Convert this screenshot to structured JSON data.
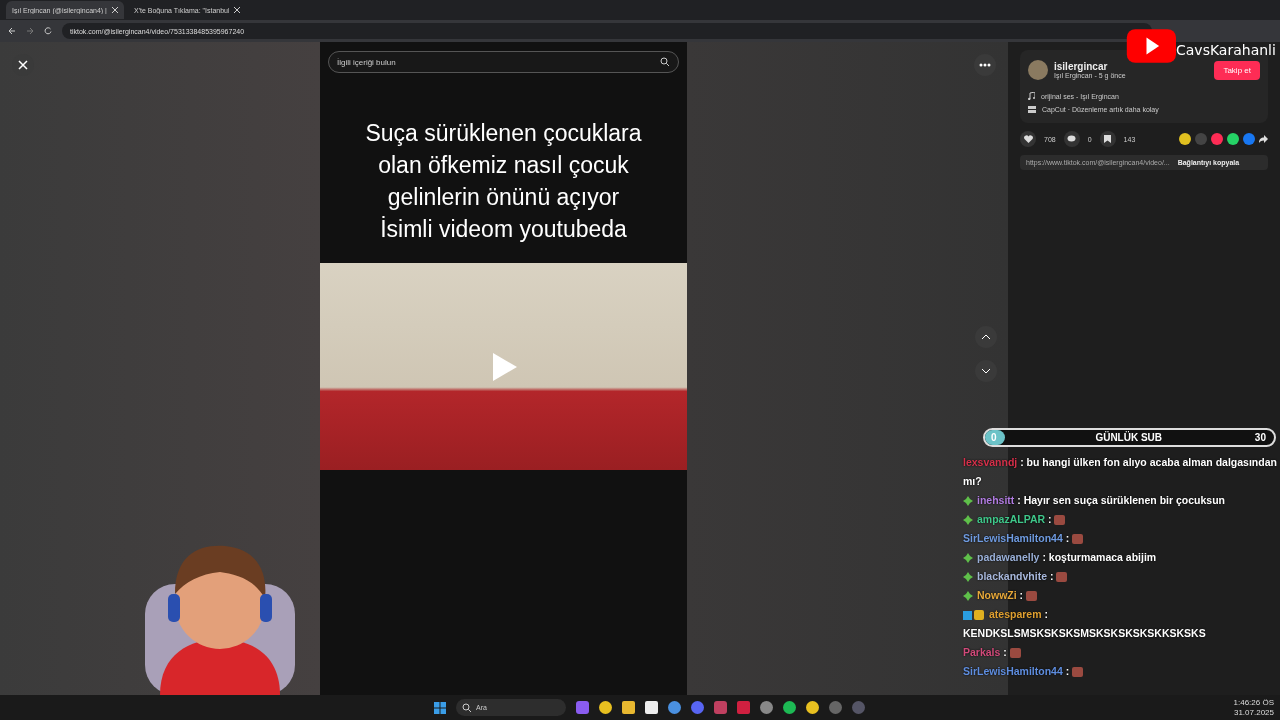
{
  "browser": {
    "tabs": [
      {
        "title": "Işıl Ergincan (@isilergincan4) |",
        "selected": true
      },
      {
        "title": "X'te Boğuna Tıklama: \"İstanbul",
        "selected": false
      }
    ],
    "url": "tiktok.com/@isilergincan4/video/7531338485395967240"
  },
  "video": {
    "search": {
      "placeholder": "İlgili içeriği bulun"
    },
    "caption_lines": [
      "Suça sürüklenen çocuklara",
      "olan öfkemiz nasıl çocuk",
      "gelinlerin önünü açıyor",
      "İsimli videom youtubeda"
    ]
  },
  "author": {
    "username": "isilergincar",
    "subtitle": "Işıl Ergincan - 5 g önce",
    "follow_button": "Takip et",
    "sound": "orijinal ses - Işıl Ergincan",
    "capcut": "CapCut · Düzenleme artık daha kolay",
    "likes": "708",
    "comments": "0",
    "saves": "143",
    "link": "https://www.tiktok.com/@isilergincan4/video/...",
    "copy_button": "Bağlantıyı kopyala"
  },
  "overlay": {
    "channel": "CavsKarahanli",
    "sub_goal": {
      "current": "0",
      "label": "GÜNLÜK SUB",
      "target": "30",
      "level": 0
    },
    "chat": [
      {
        "kind": "plain",
        "user": "lexsvanndj",
        "color": "#d6304a",
        "text": ": bu hangi ülken fon alıyo acaba alman dalgasından mı?",
        "emote": false
      },
      {
        "kind": "sub",
        "user": "inehsitt",
        "color": "#b07be0",
        "text": ": Hayır sen suça sürüklenen bir çocuksun",
        "emote": false
      },
      {
        "kind": "sub",
        "user": "ampazALPAR",
        "color": "#3fc78a",
        "text": ":",
        "emote": true
      },
      {
        "kind": "plain",
        "user": "SirLewisHamilton44",
        "color": "#6f9be0",
        "text": ":",
        "emote": true
      },
      {
        "kind": "sub",
        "user": "padawanelly",
        "color": "#9ab0d8",
        "text": ": koşturmamaca abijim",
        "emote": false
      },
      {
        "kind": "sub",
        "user": "blackandvhite",
        "color": "#a8b8dc",
        "text": ":",
        "emote": true
      },
      {
        "kind": "sub",
        "user": "NowwZi",
        "color": "#e8a93a",
        "text": ":",
        "emote": true
      },
      {
        "kind": "gifter",
        "user": "atesparem",
        "color": "#e0a030",
        "text": ": KENDKSLSMSKSKSKSMSKSKSKSKSKKSKSKS",
        "emote": false
      },
      {
        "kind": "plain",
        "user": "Parkals",
        "color": "#d24a7a",
        "text": ":",
        "emote": true
      },
      {
        "kind": "plain",
        "user": "SirLewisHamilton44",
        "color": "#5f8ee0",
        "text": ":",
        "emote": true
      }
    ]
  },
  "taskbar": {
    "search": "Ara",
    "time": "1:46:26 ÖS",
    "date": "31.07.2025"
  }
}
